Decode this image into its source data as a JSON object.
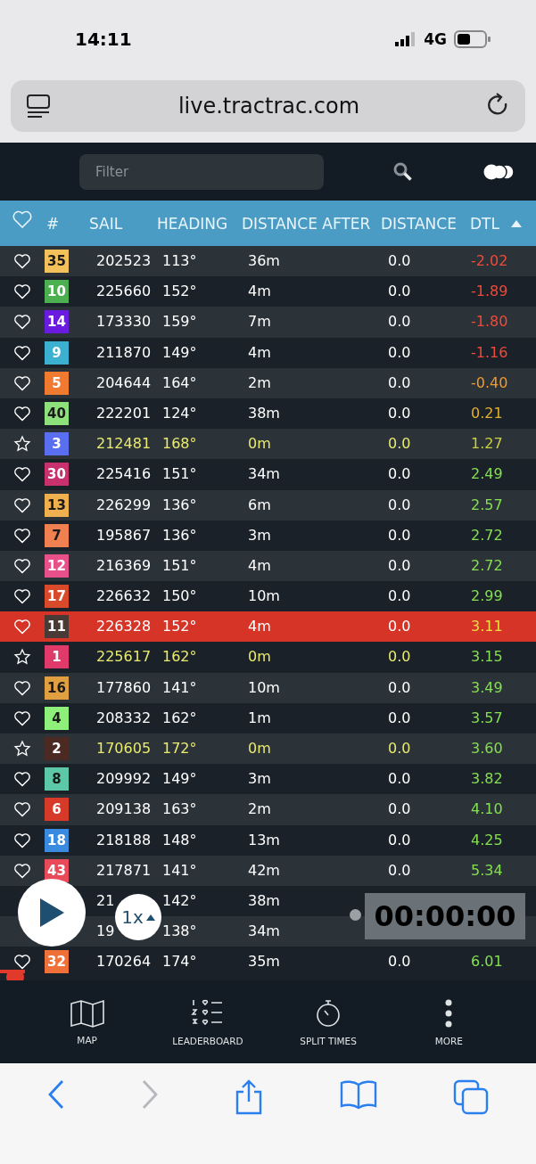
{
  "status_bar": {
    "time": "14:11",
    "network": "4G"
  },
  "browser": {
    "url": "live.tractrac.com"
  },
  "toolbar": {
    "filter": {
      "placeholder": "Filter"
    }
  },
  "table": {
    "columns": [
      "#",
      "SAIL",
      "HEADING",
      "DISTANCE AFTER",
      "DISTANCE",
      "DTL"
    ],
    "rows": [
      {
        "kind": "heart",
        "number": "35",
        "color": "#f3c15a",
        "sail": "202523",
        "heading": "113°",
        "distance_after": "36m",
        "distance": "0.0",
        "dtl": "-2.02",
        "selected": false
      },
      {
        "kind": "heart",
        "number": "10",
        "color": "#4caf50",
        "sail": "225660",
        "heading": "152°",
        "distance_after": "4m",
        "distance": "0.0",
        "dtl": "-1.89",
        "selected": false
      },
      {
        "kind": "heart",
        "number": "14",
        "color": "#6a1be0",
        "sail": "173330",
        "heading": "159°",
        "distance_after": "7m",
        "distance": "0.0",
        "dtl": "-1.80",
        "selected": false
      },
      {
        "kind": "heart",
        "number": "9",
        "color": "#3cb0d0",
        "sail": "211870",
        "heading": "149°",
        "distance_after": "4m",
        "distance": "0.0",
        "dtl": "-1.16",
        "selected": false
      },
      {
        "kind": "heart",
        "number": "5",
        "color": "#f07a30",
        "sail": "204644",
        "heading": "164°",
        "distance_after": "2m",
        "distance": "0.0",
        "dtl": "-0.40",
        "selected": false
      },
      {
        "kind": "heart",
        "number": "40",
        "color": "#8de07a",
        "sail": "222201",
        "heading": "124°",
        "distance_after": "38m",
        "distance": "0.0",
        "dtl": "0.21",
        "selected": false
      },
      {
        "kind": "star",
        "number": "3",
        "color": "#5a6ff0",
        "sail": "212481",
        "heading": "168°",
        "distance_after": "0m",
        "distance": "0.0",
        "dtl": "1.27",
        "selected": false
      },
      {
        "kind": "heart",
        "number": "30",
        "color": "#c8306e",
        "sail": "225416",
        "heading": "151°",
        "distance_after": "34m",
        "distance": "0.0",
        "dtl": "2.49",
        "selected": false
      },
      {
        "kind": "heart",
        "number": "13",
        "color": "#f0b050",
        "sail": "226299",
        "heading": "136°",
        "distance_after": "6m",
        "distance": "0.0",
        "dtl": "2.57",
        "selected": false
      },
      {
        "kind": "heart",
        "number": "7",
        "color": "#f08050",
        "sail": "195867",
        "heading": "136°",
        "distance_after": "3m",
        "distance": "0.0",
        "dtl": "2.72",
        "selected": false
      },
      {
        "kind": "heart",
        "number": "12",
        "color": "#e8508a",
        "sail": "216369",
        "heading": "151°",
        "distance_after": "4m",
        "distance": "0.0",
        "dtl": "2.72",
        "selected": false
      },
      {
        "kind": "heart",
        "number": "17",
        "color": "#d84a2a",
        "sail": "226632",
        "heading": "150°",
        "distance_after": "10m",
        "distance": "0.0",
        "dtl": "2.99",
        "selected": false
      },
      {
        "kind": "heart",
        "number": "11",
        "color": "#4a3a36",
        "sail": "226328",
        "heading": "152°",
        "distance_after": "4m",
        "distance": "0.0",
        "dtl": "3.11",
        "selected": true
      },
      {
        "kind": "star",
        "number": "1",
        "color": "#e03a6a",
        "sail": "225617",
        "heading": "162°",
        "distance_after": "0m",
        "distance": "0.0",
        "dtl": "3.15",
        "selected": false
      },
      {
        "kind": "heart",
        "number": "16",
        "color": "#e0a040",
        "sail": "177860",
        "heading": "141°",
        "distance_after": "10m",
        "distance": "0.0",
        "dtl": "3.49",
        "selected": false
      },
      {
        "kind": "heart",
        "number": "4",
        "color": "#8ef07a",
        "sail": "208332",
        "heading": "162°",
        "distance_after": "1m",
        "distance": "0.0",
        "dtl": "3.57",
        "selected": false
      },
      {
        "kind": "star",
        "number": "2",
        "color": "#4a2a22",
        "sail": "170605",
        "heading": "172°",
        "distance_after": "0m",
        "distance": "0.0",
        "dtl": "3.60",
        "selected": false
      },
      {
        "kind": "heart",
        "number": "8",
        "color": "#5cc8a8",
        "sail": "209992",
        "heading": "149°",
        "distance_after": "3m",
        "distance": "0.0",
        "dtl": "3.82",
        "selected": false
      },
      {
        "kind": "heart",
        "number": "6",
        "color": "#d83a2a",
        "sail": "209138",
        "heading": "163°",
        "distance_after": "2m",
        "distance": "0.0",
        "dtl": "4.10",
        "selected": false
      },
      {
        "kind": "heart",
        "number": "18",
        "color": "#3a8ae0",
        "sail": "218188",
        "heading": "148°",
        "distance_after": "13m",
        "distance": "0.0",
        "dtl": "4.25",
        "selected": false
      },
      {
        "kind": "heart",
        "number": "43",
        "color": "#e84a5a",
        "sail": "217871",
        "heading": "141°",
        "distance_after": "42m",
        "distance": "0.0",
        "dtl": "5.34",
        "selected": false
      },
      {
        "sail": "21",
        "heading": "142°",
        "distance_after": "38m",
        "selected": false
      },
      {
        "sail": "19",
        "heading": "138°",
        "distance_after": "34m",
        "selected": false
      },
      {
        "kind": "heart",
        "number": "32",
        "color": "#f0703a",
        "sail": "170264",
        "heading": "174°",
        "distance_after": "35m",
        "distance": "0.0",
        "dtl": "6.01",
        "selected": false
      }
    ]
  },
  "player": {
    "speed": "1x",
    "clock": "00:00:00"
  },
  "bottom_nav": [
    {
      "kind": "map",
      "label": "MAP"
    },
    {
      "kind": "leaderboard",
      "label": "LEADERBOARD"
    },
    {
      "kind": "stopwatch",
      "label": "SPLIT TIMES"
    },
    {
      "kind": "more",
      "label": "MORE"
    }
  ]
}
